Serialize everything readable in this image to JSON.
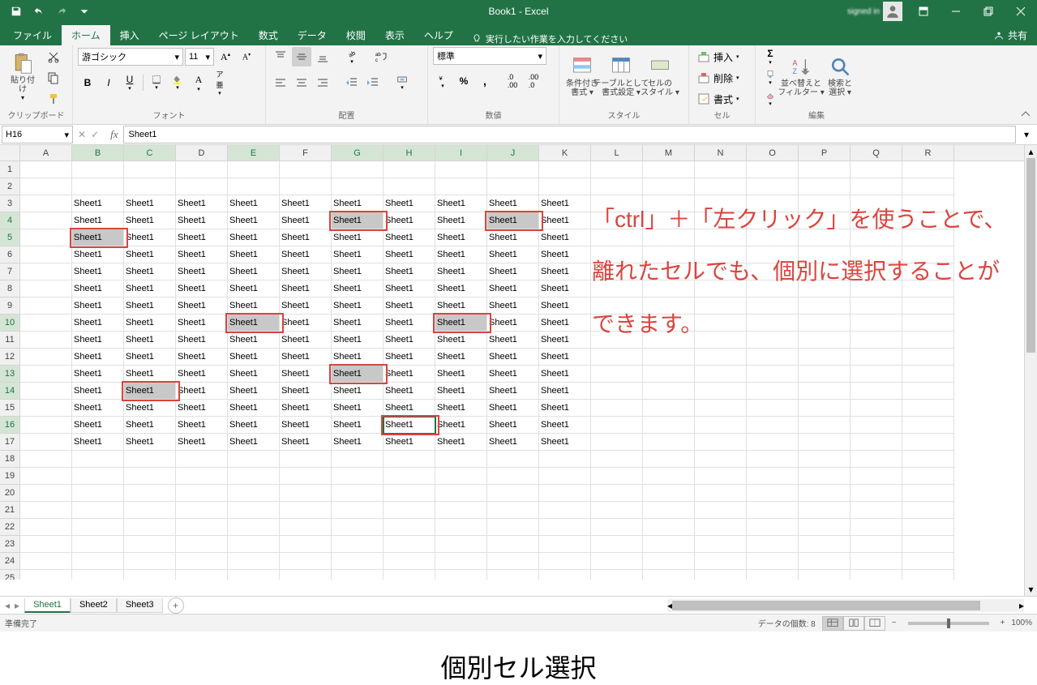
{
  "title": "Book1  -  Excel",
  "qat": {
    "save": "保存",
    "undo": "元に戻す",
    "redo": "やり直し"
  },
  "tabs": [
    "ファイル",
    "ホーム",
    "挿入",
    "ページ レイアウト",
    "数式",
    "データ",
    "校閲",
    "表示",
    "ヘルプ"
  ],
  "active_tab": 1,
  "tell_me": "実行したい作業を入力してください",
  "share": "共有",
  "ribbon": {
    "clipboard": {
      "paste": "貼り付け",
      "label": "クリップボード"
    },
    "font": {
      "name": "游ゴシック",
      "size": "11",
      "label": "フォント"
    },
    "alignment": {
      "label": "配置"
    },
    "number": {
      "format": "標準",
      "label": "数値"
    },
    "styles": {
      "cond": "条件付き\n書式 ▾",
      "table": "テーブルとして\n書式設定 ▾",
      "cell": "セルの\nスタイル ▾",
      "label": "スタイル"
    },
    "cells": {
      "insert": "挿入",
      "delete": "削除",
      "format": "書式",
      "label": "セル"
    },
    "editing": {
      "sort": "並べ替えと\nフィルター ▾",
      "find": "検索と\n選択 ▾",
      "label": "編集"
    }
  },
  "namebox": "H16",
  "formula_value": "Sheet1",
  "columns": [
    "A",
    "B",
    "C",
    "D",
    "E",
    "F",
    "G",
    "H",
    "I",
    "J",
    "K",
    "L",
    "M",
    "N",
    "O",
    "P",
    "Q",
    "R"
  ],
  "row_count": 25,
  "cell_text": "Sheet1",
  "data_cols": [
    "B",
    "C",
    "D",
    "E",
    "F",
    "G",
    "H",
    "I",
    "J",
    "K"
  ],
  "data_rows": [
    3,
    4,
    5,
    6,
    7,
    8,
    9,
    10,
    11,
    12,
    13,
    14,
    15,
    16,
    17
  ],
  "selected_cells": [
    "B5",
    "G4",
    "J4",
    "E10",
    "I10",
    "G13",
    "C14",
    "H16"
  ],
  "active_cell": "H16",
  "red_boxes": [
    "B5",
    "G4",
    "J4",
    "E10",
    "I10",
    "G13",
    "C14",
    "H16"
  ],
  "row_sel": [
    4,
    5,
    10,
    13,
    14,
    16
  ],
  "col_sel": [
    "B",
    "C",
    "E",
    "G",
    "H",
    "I",
    "J"
  ],
  "sheets": [
    "Sheet1",
    "Sheet2",
    "Sheet3"
  ],
  "active_sheet": 0,
  "status": {
    "ready": "準備完了",
    "count": "データの個数: 8",
    "zoom": "100%"
  },
  "annotation": "「ctrl」＋「左クリック」を使うことで、離れたセルでも、個別に選択することができます。",
  "caption": "個別セル選択"
}
